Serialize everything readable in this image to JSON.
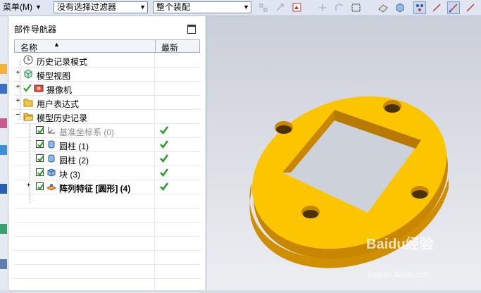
{
  "toolbar": {
    "menu_label": "菜单(M)",
    "filter_value": "没有选择过滤器",
    "assembly_scope_value": "整个装配"
  },
  "navigator": {
    "title": "部件导航器",
    "columns": {
      "name": "名称",
      "latest": "最新"
    },
    "items": [
      {
        "label": "历史记录模式"
      },
      {
        "label": "模型视图"
      },
      {
        "label": "摄像机"
      },
      {
        "label": "用户表达式"
      },
      {
        "label": "模型历史记录"
      },
      {
        "label": "基准坐标系 (0)"
      },
      {
        "label": "圆柱 (1)"
      },
      {
        "label": "圆柱 (2)"
      },
      {
        "label": "块 (3)"
      },
      {
        "label": "阵列特征 [圆形] (4)"
      }
    ]
  },
  "watermark": {
    "text": "Baidu经验",
    "sub": "jingyan.baidu.com"
  },
  "colors": {
    "part": "#f7c500",
    "part_side": "#d99a00",
    "check": "#1f9d1f"
  }
}
